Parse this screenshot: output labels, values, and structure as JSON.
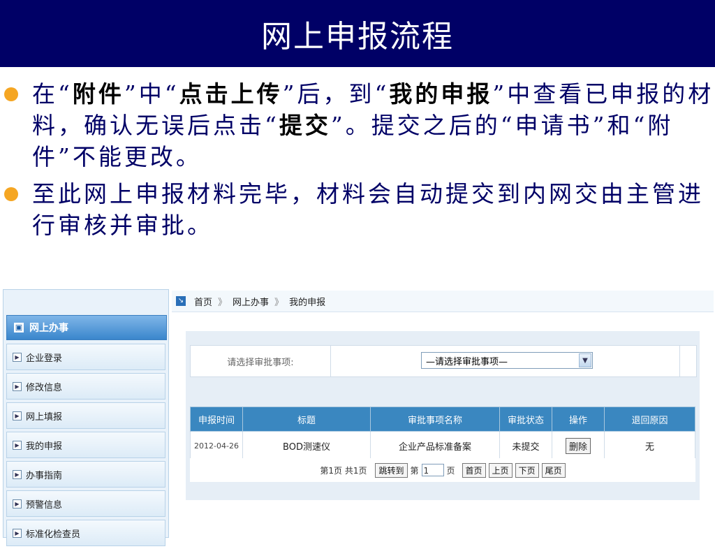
{
  "slide": {
    "title": "网上申报流程",
    "bullet1": {
      "p1": "在“",
      "b1": "附件",
      "p2": "”中“",
      "b2": "点击上传",
      "p3": "”后，到“",
      "b3": "我的申报",
      "p4": "”中查看已申报的材料，确认无误后点击“",
      "b4": "提交",
      "p5": "”。提交之后的“申请书”和“附件”不能更改。"
    },
    "bullet2": "至此网上申报材料完毕，材料会自动提交到内网交由主管进行审核并审批。",
    "bullet_color": "#f5a623",
    "title_bg": "#000066"
  },
  "sidebar": {
    "header": "网上办事",
    "items": [
      {
        "label": "企业登录"
      },
      {
        "label": "修改信息"
      },
      {
        "label": "网上填报"
      },
      {
        "label": "我的申报"
      },
      {
        "label": "办事指南"
      },
      {
        "label": "预警信息"
      },
      {
        "label": "标准化检查员"
      }
    ]
  },
  "breadcrumb": {
    "home": "首页",
    "sep": "》",
    "level1": "网上办事",
    "level2": "我的申报"
  },
  "filter": {
    "label": "请选择审批事项:",
    "selected": "—请选择审批事项—"
  },
  "table": {
    "headers": [
      "申报时间",
      "标题",
      "审批事项名称",
      "审批状态",
      "操作",
      "退回原因"
    ],
    "rows": [
      {
        "date": "2012-04-26",
        "title": "BOD测速仪",
        "item": "企业产品标准备案",
        "status": "未提交",
        "action": "删除",
        "reason": "无"
      }
    ],
    "header_color": "#3a87c0"
  },
  "pager": {
    "info": "第1页 共1页",
    "jump_label": "跳转到",
    "page_prefix": "第",
    "page_value": "1",
    "page_suffix": "页",
    "first": "首页",
    "prev": "上页",
    "next": "下页",
    "last": "尾页"
  }
}
